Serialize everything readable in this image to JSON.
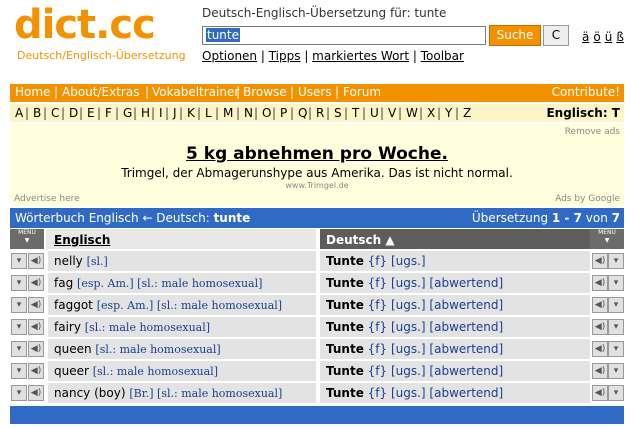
{
  "header": {
    "logo": "dict.cc",
    "logo_sub": "Deutsch/Englisch-Übersetzung",
    "trans_title": "Deutsch-Englisch-Übersetzung für: tunte",
    "search_value": "tunte",
    "search_button": "Suche",
    "clear_button": "C",
    "special_chars": [
      "ä",
      "ö",
      "ü",
      "ß"
    ],
    "links": [
      "Optionen",
      "Tipps",
      "markiertes Wort",
      "Toolbar"
    ]
  },
  "nav": {
    "items": [
      "Home",
      "About/Extras",
      "Vokabeltrainer",
      "Browse",
      "Users",
      "Forum"
    ],
    "contribute": "Contribute!"
  },
  "alphabet": {
    "letters": [
      "A",
      "B",
      "C",
      "D",
      "E",
      "F",
      "G",
      "H",
      "I",
      "J",
      "K",
      "L",
      "M",
      "N",
      "O",
      "P",
      "Q",
      "R",
      "S",
      "T",
      "U",
      "V",
      "W",
      "X",
      "Y",
      "Z"
    ],
    "label": "Englisch: T"
  },
  "ad": {
    "remove": "Remove ads",
    "headline": "5 kg abnehmen pro Woche.",
    "text": "Trimgel, der Abmagerunshype aus Amerika. Das ist nicht normal.",
    "url": "www.Trimgel.de",
    "advertise": "Advertise here",
    "ads_by": "Ads by Google"
  },
  "dictbar": {
    "left_prefix": "Wörterbuch Englisch ← Deutsch: ",
    "left_term": "tunte",
    "right_prefix": "Übersetzung ",
    "range": "1 - 7",
    "of": " von ",
    "total": "7"
  },
  "table": {
    "menu_label": "MENU",
    "col_en": "Englisch",
    "col_de": "Deutsch ▲",
    "rows": [
      {
        "en": "nelly",
        "en_tags": "[sl.]",
        "de": "Tunte",
        "de_tags": "{f} [ugs.]"
      },
      {
        "en": "fag",
        "en_tags": "[esp. Am.] [sl.: male homosexual]",
        "de": "Tunte",
        "de_tags": "{f} [ugs.] [abwertend]"
      },
      {
        "en": "faggot",
        "en_tags": "[esp. Am.] [sl.: male homosexual]",
        "de": "Tunte",
        "de_tags": "{f} [ugs.] [abwertend]"
      },
      {
        "en": "fairy",
        "en_tags": "[sl.: male homosexual]",
        "de": "Tunte",
        "de_tags": "{f} [ugs.] [abwertend]"
      },
      {
        "en": "queen",
        "en_tags": "[sl.: male homosexual]",
        "de": "Tunte",
        "de_tags": "{f} [ugs.] [abwertend]"
      },
      {
        "en": "queer",
        "en_tags": "[sl.: male homosexual]",
        "de": "Tunte",
        "de_tags": "{f} [ugs.] [abwertend]"
      },
      {
        "en": "nancy (boy)",
        "en_tags": "[Br.] [sl.: male homosexual]",
        "de": "Tunte",
        "de_tags": "{f} [ugs.] [abwertend]"
      }
    ]
  },
  "colors": {
    "orange": "#f39200",
    "blue": "#316ac5",
    "cream": "#ffffdd"
  }
}
